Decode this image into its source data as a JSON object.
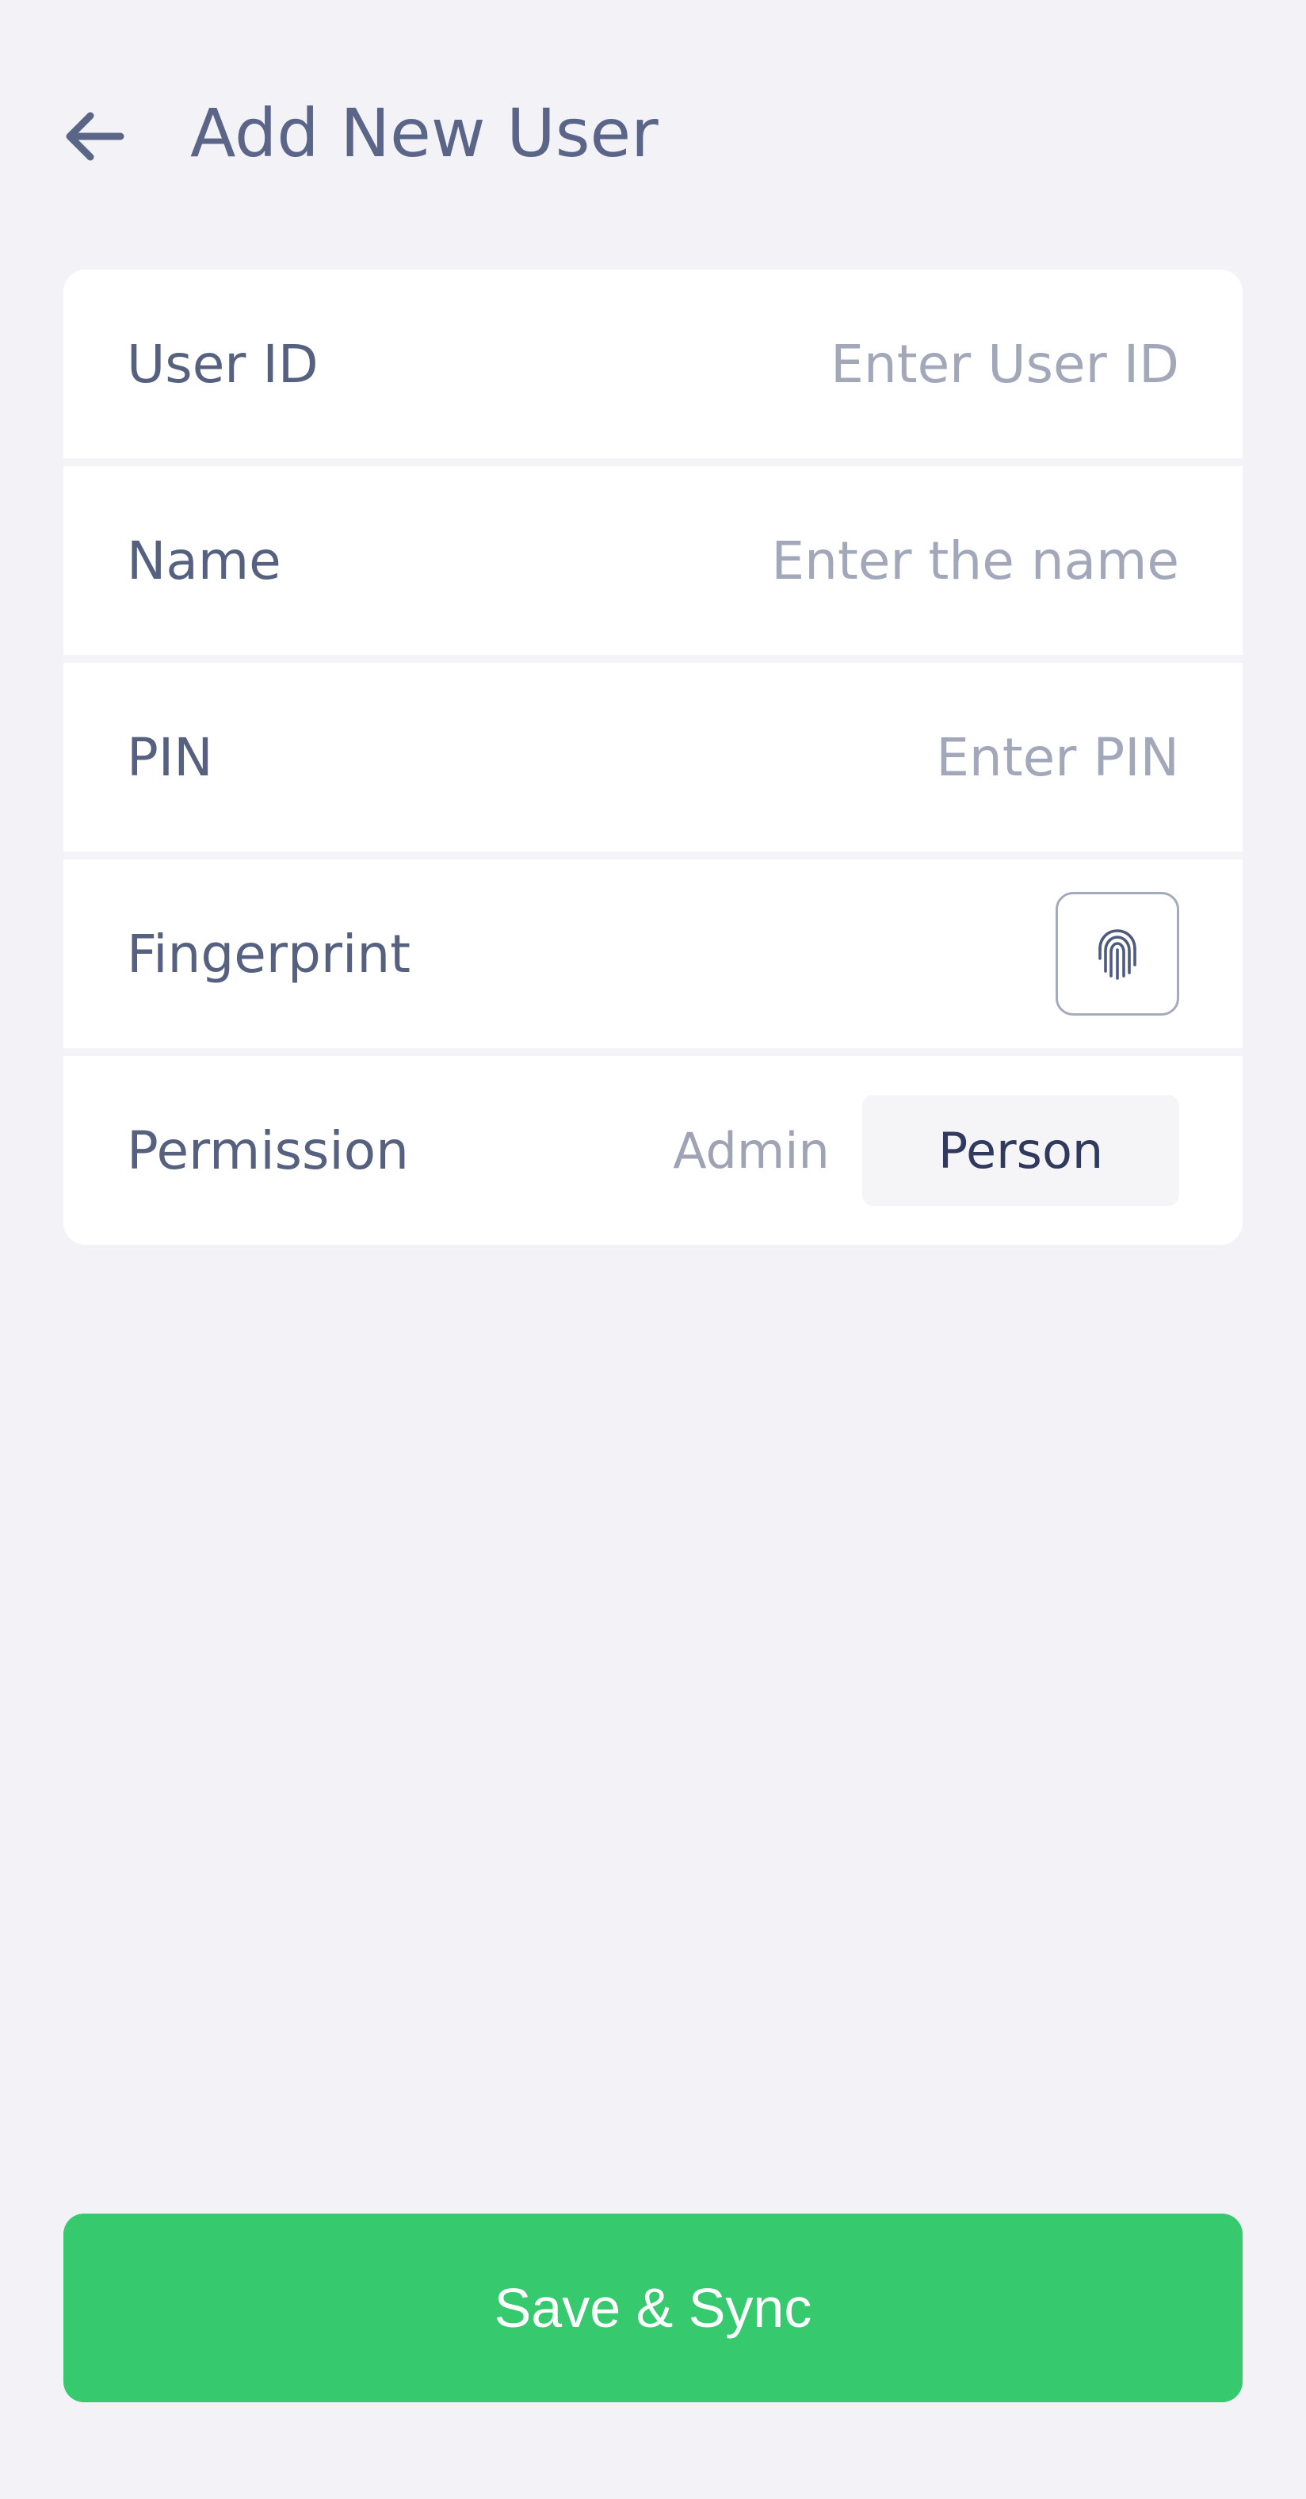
{
  "header": {
    "title": "Add New User",
    "back_icon": "arrow-left-icon"
  },
  "form": {
    "user_id": {
      "label": "User ID",
      "value": "",
      "placeholder": "Enter User ID"
    },
    "name": {
      "label": "Name",
      "value": "",
      "placeholder": "Enter the name"
    },
    "pin": {
      "label": "PIN",
      "value": "",
      "placeholder": "Enter PIN"
    },
    "fingerprint": {
      "label": "Fingerprint",
      "icon": "fingerprint-icon"
    },
    "permission": {
      "label": "Permission",
      "options": [
        "Admin",
        "Person"
      ],
      "selected": "Person"
    }
  },
  "actions": {
    "save_label": "Save & Sync"
  },
  "colors": {
    "background": "#f2f2f7",
    "card": "#ffffff",
    "primary_text": "#56617f",
    "placeholder_text": "#a2a8ba",
    "accent_green": "#36c96e"
  }
}
